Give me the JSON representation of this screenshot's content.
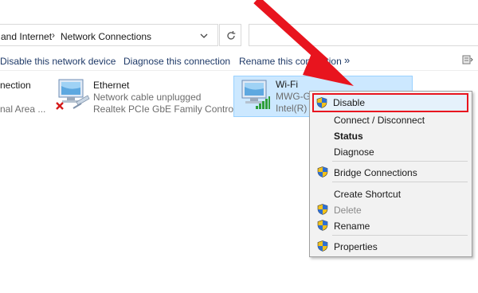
{
  "address_bar": {
    "crumb_parent": "and Internet",
    "crumb_current": "Network Connections",
    "search_placeholder": ""
  },
  "command_bar": {
    "disable_label": "Disable this network device",
    "diagnose_label": "Diagnose this connection",
    "rename_label": "Rename this connection",
    "more_label": "»"
  },
  "adapters": [
    {
      "name": "nection",
      "line1": "",
      "line2": "nal Area ..."
    },
    {
      "name": "Ethernet",
      "line1": "Network cable unplugged",
      "line2": "Realtek PCIe GbE Family Controller",
      "status_icon": "red-x-icon"
    },
    {
      "name": "Wi-Fi",
      "line1": "MWG-Gu",
      "line2": "Intel(R) D",
      "status_icon": "signal-bars-icon",
      "selected": true
    }
  ],
  "context_menu": {
    "items": [
      {
        "label": "Disable",
        "shield": true,
        "highlighted": true
      },
      {
        "label": "Connect / Disconnect",
        "shield": false
      },
      {
        "label": "Status",
        "shield": false,
        "bold": true
      },
      {
        "label": "Diagnose",
        "shield": false
      },
      {
        "label": "Bridge Connections",
        "shield": true
      },
      {
        "label": "Create Shortcut",
        "shield": false
      },
      {
        "label": "Delete",
        "shield": true,
        "disabled": true
      },
      {
        "label": "Rename",
        "shield": true
      },
      {
        "label": "Properties",
        "shield": true
      }
    ]
  },
  "colors": {
    "annotation_red": "#e8141e",
    "selection_blue": "#cce8ff",
    "command_text": "#1f3a68"
  }
}
